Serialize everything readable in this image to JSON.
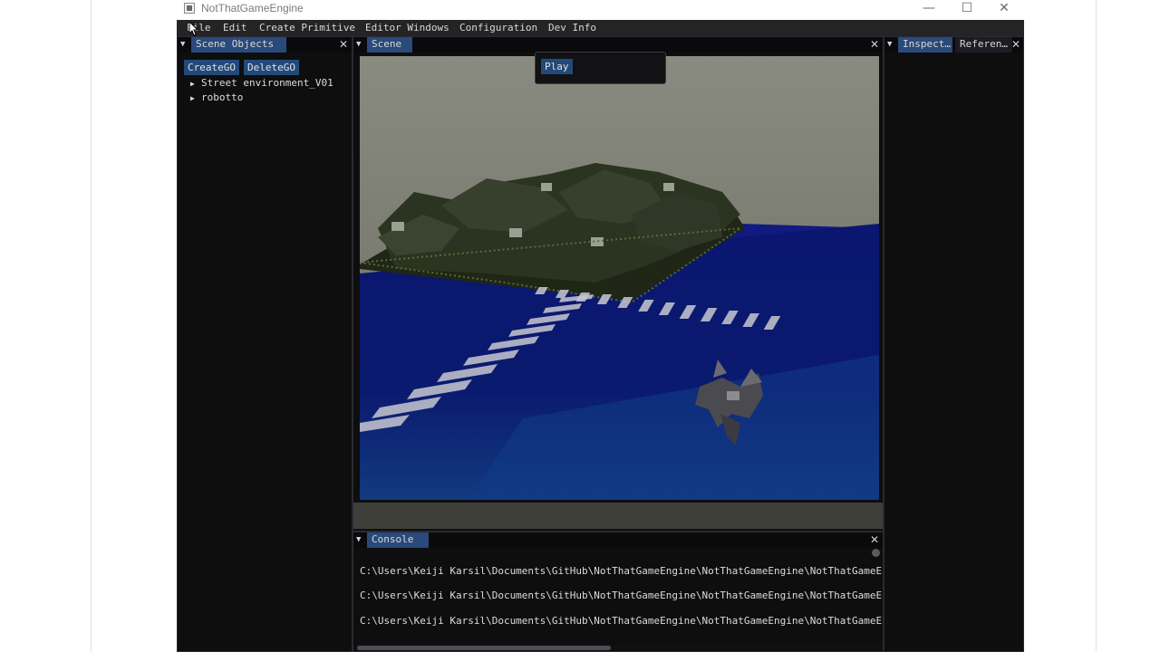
{
  "window": {
    "title": "NotThatGameEngine",
    "controls": {
      "minimize": "—",
      "maximize": "☐",
      "close": "✕"
    }
  },
  "menu": {
    "items": [
      {
        "label": "File"
      },
      {
        "label": "Edit"
      },
      {
        "label": "Create Primitive"
      },
      {
        "label": "Editor Windows"
      },
      {
        "label": "Configuration"
      },
      {
        "label": "Dev Info"
      }
    ]
  },
  "scene_objects": {
    "tab_label": "Scene Objects",
    "create_button": "CreateGO",
    "delete_button": "DeleteGO",
    "tree": [
      {
        "label": "Street environment_V01"
      },
      {
        "label": "robotto"
      }
    ]
  },
  "scene": {
    "tab_label": "Scene",
    "play_button": "Play"
  },
  "inspector": {
    "tabs": [
      {
        "label": "Inspect…",
        "active": true
      },
      {
        "label": "Referen…",
        "active": false
      }
    ]
  },
  "console": {
    "tab_label": "Console",
    "lines": [
      "C:\\Users\\Keiji Karsil\\Documents\\GitHub\\NotThatGameEngine\\NotThatGameEngine\\NotThatGameEr",
      "C:\\Users\\Keiji Karsil\\Documents\\GitHub\\NotThatGameEngine\\NotThatGameEngine\\NotThatGameEr",
      "C:\\Users\\Keiji Karsil\\Documents\\GitHub\\NotThatGameEngine\\NotThatGameEngine\\NotThatGameEr"
    ]
  },
  "icons": {
    "collapse": "▼",
    "close": "✕",
    "tree_arrow": "▶"
  },
  "colors": {
    "accent": "#294a7a",
    "button": "#23497a",
    "background": "#0e0e0f"
  }
}
